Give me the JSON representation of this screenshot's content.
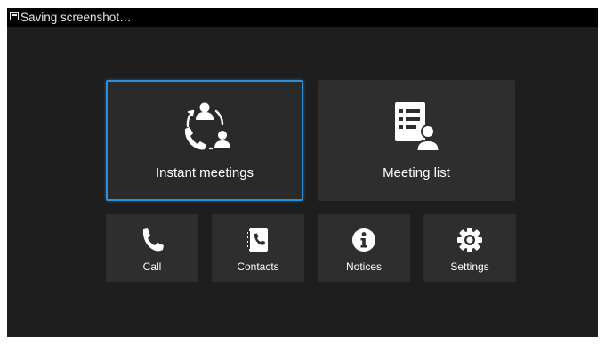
{
  "status_bar": {
    "text": "Saving screenshot…",
    "icon": "screenshot-icon"
  },
  "main_tiles": [
    {
      "label": "Instant meetings",
      "icon": "instant-meetings-icon",
      "selected": true
    },
    {
      "label": "Meeting list",
      "icon": "meeting-list-icon",
      "selected": false
    }
  ],
  "small_tiles": [
    {
      "label": "Call",
      "icon": "phone-icon"
    },
    {
      "label": "Contacts",
      "icon": "contacts-icon"
    },
    {
      "label": "Notices",
      "icon": "info-icon"
    },
    {
      "label": "Settings",
      "icon": "gear-icon"
    }
  ],
  "colors": {
    "background": "#1e1e1e",
    "tile": "#2e2e2e",
    "selection_border": "#2f8fd8",
    "text": "#ffffff"
  }
}
